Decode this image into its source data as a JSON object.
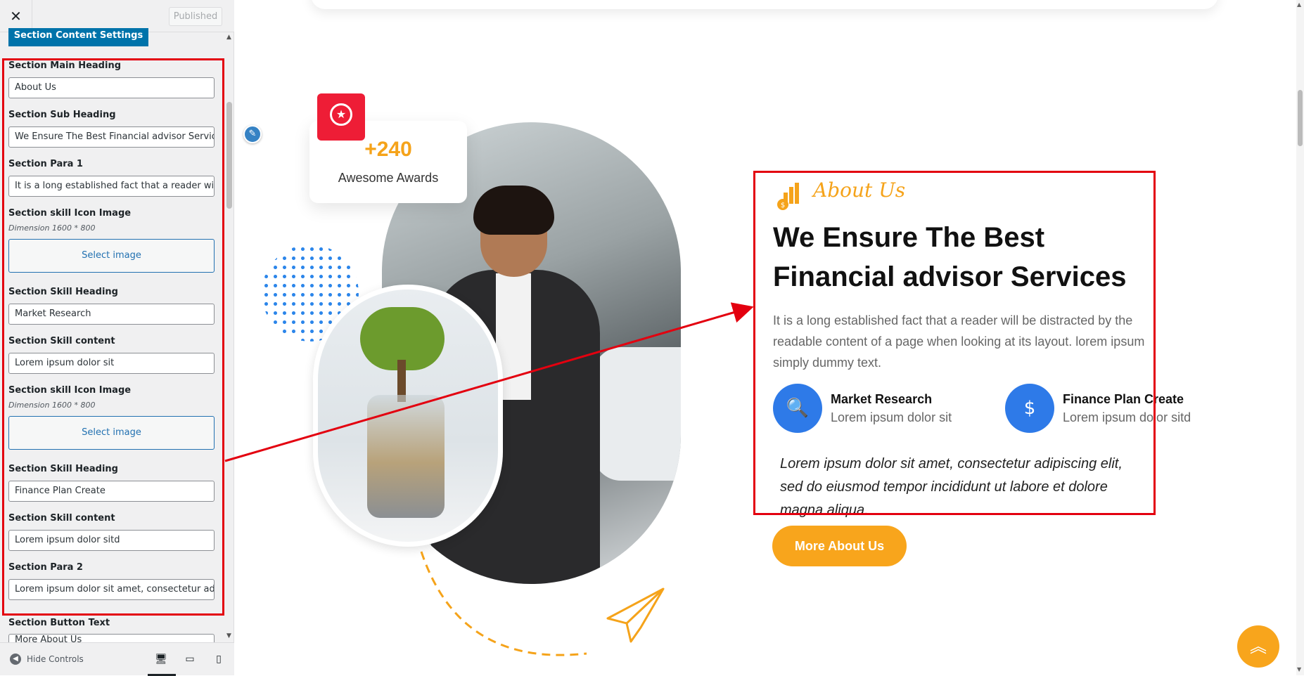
{
  "sidebar": {
    "close_label": "✕",
    "published_label": "Published",
    "section_tab": "Section Content Settings",
    "controls": {
      "main_heading": {
        "label": "Section Main Heading",
        "value": "About Us"
      },
      "sub_heading": {
        "label": "Section Sub Heading",
        "value": "We Ensure The Best Financial advisor Services"
      },
      "para1": {
        "label": "Section Para 1",
        "value": "It is a long established fact that a reader will be distracted"
      },
      "skill_icon_1": {
        "label": "Section skill Icon Image",
        "desc": "Dimension 1600 * 800",
        "button": "Select image"
      },
      "skill_heading_1": {
        "label": "Section Skill Heading",
        "value": "Market Research"
      },
      "skill_content_1": {
        "label": "Section Skill content",
        "value": "Lorem ipsum dolor sit"
      },
      "skill_icon_2": {
        "label": "Section skill Icon Image",
        "desc": "Dimension 1600 * 800",
        "button": "Select image"
      },
      "skill_heading_2": {
        "label": "Section Skill Heading",
        "value": "Finance Plan Create"
      },
      "skill_content_2": {
        "label": "Section Skill content",
        "value": "Lorem ipsum dolor sitd"
      },
      "para2": {
        "label": "Section Para 2",
        "value": "Lorem ipsum dolor sit amet, consectetur adipiscing elit"
      },
      "button_text": {
        "label": "Section Button Text",
        "value": "More About Us"
      }
    },
    "footer": {
      "hide_controls": "Hide Controls"
    }
  },
  "preview": {
    "award": {
      "number": "+240",
      "label": "Awesome Awards"
    },
    "about_tag": "About Us",
    "main_heading": "We Ensure The Best Financial advisor Services",
    "para1": "It is a long established fact that a reader will be distracted by the readable content of a page when looking at its layout. lorem ipsum simply dummy text.",
    "skills": [
      {
        "title": "Market Research",
        "content": "Lorem ipsum dolor sit",
        "icon": "magnifier-chart-icon"
      },
      {
        "title": "Finance Plan Create",
        "content": "Lorem ipsum dolor sitd",
        "icon": "finance-plan-icon"
      }
    ],
    "para2": "Lorem ipsum dolor sit amet, consectetur adipiscing elit, sed do eiusmod tempor incididunt ut labore et dolore magna aliqua.",
    "button": "More About Us",
    "back_to_top": "︽"
  },
  "colors": {
    "accent": "#f8a51c",
    "highlight_box": "#e3000f",
    "wp_blue": "#0073aa",
    "skill_icon": "#2e7ae8"
  }
}
